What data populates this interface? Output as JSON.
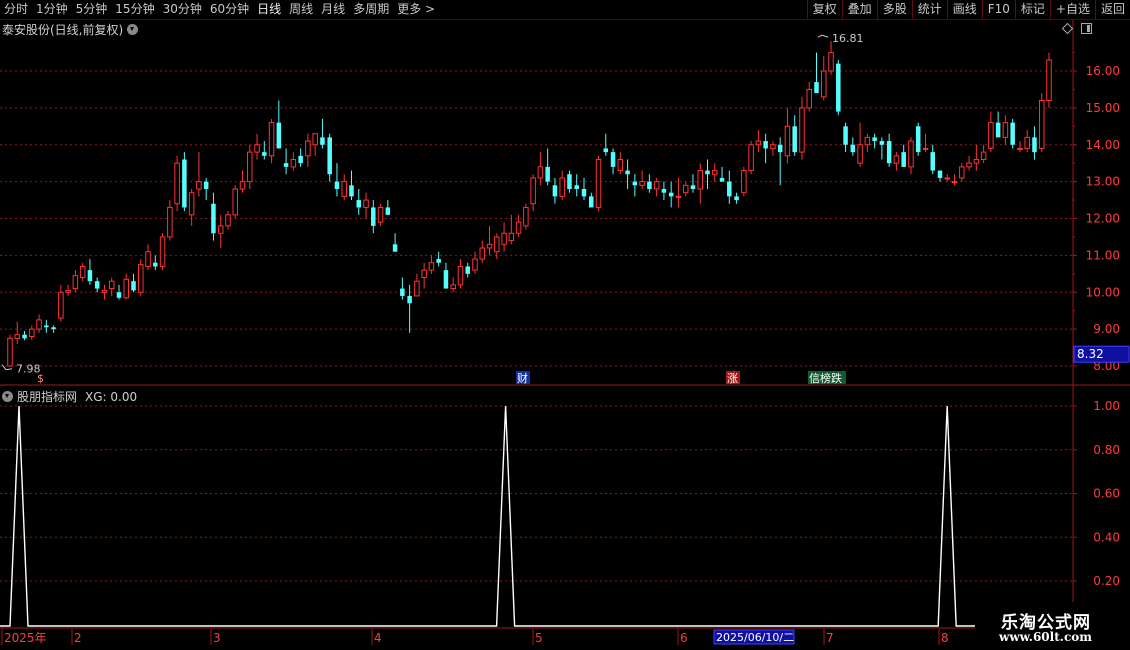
{
  "toolbar": {
    "periods": [
      "分时",
      "1分钟",
      "5分钟",
      "15分钟",
      "30分钟",
      "60分钟",
      "日线",
      "周线",
      "月线",
      "多周期",
      "更多 >"
    ],
    "active_period": "日线",
    "tools": [
      "复权",
      "叠加",
      "多股",
      "统计",
      "画线",
      "F10",
      "标记",
      "+自选",
      "返回"
    ]
  },
  "main_title": "泰安股份(日线,前复权)",
  "indicator_title": "股朋指标网",
  "indicator_value": "XG: 0.00",
  "price_axis": [
    "16.00",
    "15.00",
    "14.00",
    "13.00",
    "12.00",
    "11.00",
    "10.00",
    "9.00",
    "8.00"
  ],
  "indicator_axis": [
    "1.00",
    "0.80",
    "0.60",
    "0.40",
    "0.20"
  ],
  "current_price": "8.32",
  "max_label": "16.81",
  "min_label": "7.98",
  "markers": [
    "$",
    "财",
    "涨",
    "信榜跌"
  ],
  "date_axis": [
    "2025年",
    "2",
    "3",
    "4",
    "5",
    "6",
    "7",
    "8"
  ],
  "cursor_date": "2025/06/10/二",
  "watermark": {
    "line1": "乐淘公式网",
    "line2": "www.60lt.com"
  },
  "colors": {
    "up": "#ff3232",
    "down": "#54ffff",
    "grid": "#8a1a1a",
    "border": "#a01818"
  },
  "chart_data": {
    "type": "candlestick",
    "ohlc": [
      [
        8.0,
        8.85,
        7.98,
        8.75
      ],
      [
        8.75,
        9.2,
        8.6,
        8.85
      ],
      [
        8.85,
        8.95,
        8.7,
        8.75
      ],
      [
        8.8,
        9.1,
        8.7,
        9.0
      ],
      [
        9.0,
        9.4,
        8.9,
        9.25
      ],
      [
        9.1,
        9.25,
        8.9,
        9.05
      ],
      [
        9.05,
        9.1,
        8.9,
        9.0
      ],
      [
        9.3,
        10.2,
        9.2,
        10.0
      ],
      [
        10.0,
        10.2,
        9.9,
        10.05
      ],
      [
        10.1,
        10.6,
        10.0,
        10.45
      ],
      [
        10.4,
        10.8,
        10.3,
        10.7
      ],
      [
        10.6,
        10.9,
        10.2,
        10.3
      ],
      [
        10.3,
        10.4,
        10.0,
        10.1
      ],
      [
        10.0,
        10.2,
        9.8,
        10.05
      ],
      [
        10.1,
        10.4,
        9.9,
        10.3
      ],
      [
        10.0,
        10.2,
        9.8,
        9.85
      ],
      [
        9.85,
        10.5,
        9.8,
        10.35
      ],
      [
        10.3,
        10.5,
        10.0,
        10.05
      ],
      [
        10.0,
        10.9,
        9.9,
        10.75
      ],
      [
        10.7,
        11.3,
        10.6,
        11.1
      ],
      [
        10.8,
        11.0,
        10.6,
        10.7
      ],
      [
        10.7,
        11.6,
        10.6,
        11.5
      ],
      [
        11.5,
        12.5,
        11.4,
        12.3
      ],
      [
        12.4,
        13.7,
        12.2,
        13.5
      ],
      [
        13.6,
        13.8,
        12.2,
        12.3
      ],
      [
        12.1,
        12.8,
        11.8,
        12.7
      ],
      [
        12.8,
        13.8,
        12.6,
        13.0
      ],
      [
        13.0,
        13.1,
        12.5,
        12.8
      ],
      [
        12.4,
        12.7,
        11.4,
        11.6
      ],
      [
        11.6,
        12.1,
        11.2,
        11.8
      ],
      [
        11.8,
        12.2,
        11.7,
        12.1
      ],
      [
        12.1,
        12.9,
        12.0,
        12.8
      ],
      [
        12.8,
        13.3,
        12.7,
        13.0
      ],
      [
        13.0,
        14.0,
        12.8,
        13.8
      ],
      [
        13.8,
        14.3,
        13.6,
        14.0
      ],
      [
        13.8,
        14.1,
        13.6,
        13.7
      ],
      [
        13.7,
        14.7,
        13.5,
        14.6
      ],
      [
        14.6,
        15.2,
        13.9,
        13.9
      ],
      [
        13.5,
        13.9,
        13.2,
        13.4
      ],
      [
        13.4,
        13.8,
        13.3,
        13.6
      ],
      [
        13.7,
        13.9,
        13.4,
        13.5
      ],
      [
        13.7,
        14.3,
        13.4,
        14.1
      ],
      [
        14.0,
        14.3,
        13.7,
        14.3
      ],
      [
        14.2,
        14.7,
        13.9,
        14.0
      ],
      [
        14.2,
        14.3,
        13.0,
        13.2
      ],
      [
        13.0,
        13.5,
        12.6,
        12.8
      ],
      [
        12.6,
        13.2,
        12.5,
        13.0
      ],
      [
        12.9,
        13.3,
        12.5,
        12.6
      ],
      [
        12.5,
        12.8,
        12.1,
        12.3
      ],
      [
        12.3,
        12.7,
        12.0,
        12.5
      ],
      [
        12.3,
        12.5,
        11.6,
        11.8
      ],
      [
        11.9,
        12.4,
        11.8,
        12.3
      ],
      [
        12.3,
        12.5,
        12.1,
        12.1
      ],
      [
        11.3,
        11.6,
        11.1,
        11.1
      ],
      [
        10.1,
        10.4,
        9.8,
        9.9
      ],
      [
        9.9,
        10.2,
        8.9,
        9.7
      ],
      [
        9.9,
        10.5,
        9.9,
        10.3
      ],
      [
        10.4,
        10.8,
        10.1,
        10.6
      ],
      [
        10.6,
        11.0,
        10.5,
        10.8
      ],
      [
        10.9,
        11.1,
        10.7,
        10.8
      ],
      [
        10.6,
        10.8,
        10.1,
        10.1
      ],
      [
        10.1,
        10.4,
        10.0,
        10.2
      ],
      [
        10.2,
        10.9,
        10.1,
        10.7
      ],
      [
        10.7,
        10.8,
        10.4,
        10.5
      ],
      [
        10.6,
        11.1,
        10.5,
        10.9
      ],
      [
        10.9,
        11.4,
        10.8,
        11.2
      ],
      [
        11.2,
        11.8,
        11.0,
        11.3
      ],
      [
        11.1,
        11.6,
        10.9,
        11.5
      ],
      [
        11.3,
        11.9,
        11.1,
        11.6
      ],
      [
        11.4,
        12.1,
        11.3,
        11.6
      ],
      [
        11.6,
        12.1,
        11.5,
        11.9
      ],
      [
        11.8,
        12.4,
        11.7,
        12.3
      ],
      [
        12.4,
        13.2,
        12.2,
        13.1
      ],
      [
        13.1,
        13.8,
        12.9,
        13.4
      ],
      [
        13.4,
        13.9,
        12.9,
        13.0
      ],
      [
        12.9,
        13.1,
        12.4,
        12.6
      ],
      [
        12.6,
        13.3,
        12.5,
        13.1
      ],
      [
        13.2,
        13.3,
        12.7,
        12.8
      ],
      [
        12.9,
        13.2,
        12.6,
        12.8
      ],
      [
        12.8,
        13.1,
        12.5,
        12.6
      ],
      [
        12.6,
        12.7,
        12.3,
        12.3
      ],
      [
        12.3,
        13.7,
        12.2,
        13.6
      ],
      [
        13.9,
        14.3,
        13.7,
        13.8
      ],
      [
        13.8,
        13.9,
        13.2,
        13.4
      ],
      [
        13.3,
        13.8,
        13.2,
        13.6
      ],
      [
        13.3,
        13.6,
        12.8,
        13.2
      ],
      [
        13.0,
        13.2,
        12.6,
        12.9
      ],
      [
        12.9,
        13.3,
        12.8,
        13.0
      ],
      [
        13.0,
        13.2,
        12.7,
        12.8
      ],
      [
        12.8,
        13.1,
        12.6,
        13.0
      ],
      [
        12.8,
        13.0,
        12.5,
        12.7
      ],
      [
        12.7,
        13.0,
        12.3,
        12.6
      ],
      [
        12.6,
        13.1,
        12.3,
        12.6
      ],
      [
        12.7,
        13.0,
        12.6,
        12.9
      ],
      [
        12.9,
        13.2,
        12.7,
        12.8
      ],
      [
        12.8,
        13.5,
        12.4,
        13.3
      ],
      [
        13.3,
        13.6,
        12.8,
        13.2
      ],
      [
        13.2,
        13.5,
        13.0,
        13.3
      ],
      [
        13.1,
        13.4,
        13.0,
        13.0
      ],
      [
        13.0,
        13.3,
        12.4,
        12.6
      ],
      [
        12.6,
        12.7,
        12.4,
        12.5
      ],
      [
        12.7,
        13.4,
        12.6,
        13.3
      ],
      [
        13.3,
        14.1,
        13.2,
        14.0
      ],
      [
        14.0,
        14.4,
        13.8,
        14.1
      ],
      [
        14.1,
        14.3,
        13.5,
        13.9
      ],
      [
        13.9,
        14.1,
        13.7,
        14.0
      ],
      [
        14.0,
        14.2,
        12.9,
        13.8
      ],
      [
        13.7,
        15.0,
        13.5,
        14.5
      ],
      [
        14.5,
        14.8,
        13.7,
        13.8
      ],
      [
        13.8,
        15.3,
        13.6,
        15.0
      ],
      [
        15.0,
        15.7,
        14.9,
        15.5
      ],
      [
        15.7,
        16.5,
        15.5,
        15.4
      ],
      [
        15.3,
        16.4,
        15.2,
        16.0
      ],
      [
        16.0,
        16.81,
        15.9,
        16.5
      ],
      [
        16.2,
        16.3,
        14.8,
        14.9
      ],
      [
        14.5,
        14.6,
        13.8,
        14.0
      ],
      [
        14.0,
        14.2,
        13.7,
        13.8
      ],
      [
        13.5,
        14.6,
        13.4,
        14.0
      ],
      [
        14.0,
        14.3,
        13.8,
        14.2
      ],
      [
        14.2,
        14.3,
        13.9,
        14.1
      ],
      [
        14.1,
        14.2,
        13.6,
        14.0
      ],
      [
        14.1,
        14.3,
        13.4,
        13.5
      ],
      [
        13.5,
        13.8,
        13.3,
        13.7
      ],
      [
        13.8,
        14.0,
        13.4,
        13.4
      ],
      [
        13.4,
        14.2,
        13.2,
        14.1
      ],
      [
        14.5,
        14.6,
        13.7,
        13.8
      ],
      [
        13.9,
        14.3,
        13.8,
        13.9
      ],
      [
        13.8,
        14.0,
        13.2,
        13.3
      ],
      [
        13.3,
        13.3,
        13.0,
        13.1
      ],
      [
        13.1,
        13.2,
        13.0,
        13.1
      ],
      [
        13.0,
        13.2,
        12.9,
        13.0
      ],
      [
        13.1,
        13.5,
        13.0,
        13.4
      ],
      [
        13.4,
        13.7,
        13.3,
        13.5
      ],
      [
        13.5,
        14.0,
        13.3,
        13.6
      ],
      [
        13.6,
        14.0,
        13.5,
        13.8
      ],
      [
        13.9,
        14.9,
        13.8,
        14.6
      ],
      [
        14.6,
        14.9,
        14.2,
        14.2
      ],
      [
        14.2,
        14.8,
        14.0,
        14.6
      ],
      [
        14.6,
        14.7,
        13.9,
        14.0
      ],
      [
        13.9,
        14.1,
        13.8,
        13.9
      ],
      [
        13.9,
        14.4,
        13.8,
        14.2
      ],
      [
        14.2,
        14.5,
        13.6,
        13.8
      ],
      [
        13.9,
        15.4,
        13.8,
        15.2
      ],
      [
        15.2,
        16.5,
        15.0,
        16.3
      ]
    ],
    "xg_signal_positions": [
      0.0,
      0.477,
      0.902
    ]
  }
}
